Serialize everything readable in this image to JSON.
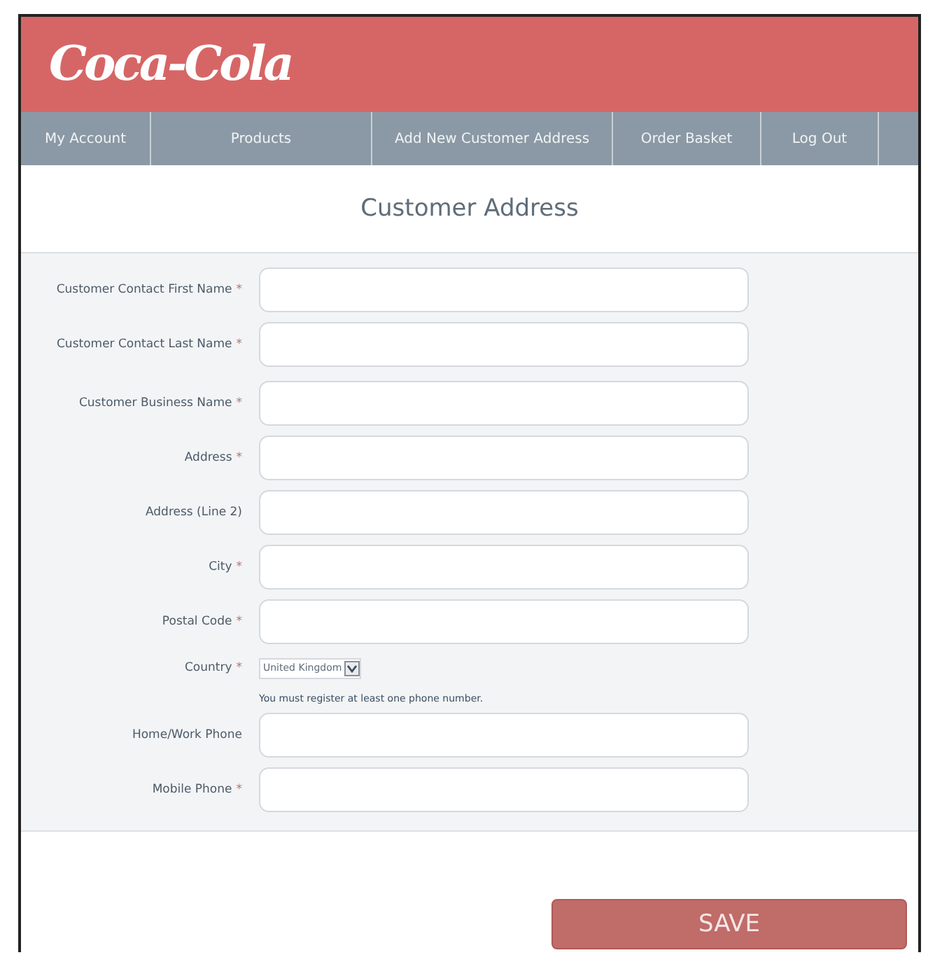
{
  "logo": {
    "text": "Coca-Cola"
  },
  "nav": [
    {
      "label": "My Account"
    },
    {
      "label": "Products"
    },
    {
      "label": "Add New Customer Address"
    },
    {
      "label": "Order Basket"
    },
    {
      "label": "Log Out"
    }
  ],
  "page_title": "Customer Address",
  "sections": [
    {
      "fields": [
        {
          "kind": "text",
          "label": "Customer Contact First Name",
          "marker": "*"
        },
        {
          "kind": "text",
          "label": "Customer Contact Last Name",
          "marker": "*"
        }
      ]
    },
    {
      "fields": [
        {
          "kind": "text",
          "label": "Customer Business Name",
          "marker": "*"
        },
        {
          "kind": "text",
          "label": "Address",
          "marker": "*"
        },
        {
          "kind": "text",
          "label": "Address (Line 2)"
        },
        {
          "kind": "text",
          "label": "City",
          "marker": "*"
        },
        {
          "kind": "text",
          "label": "Postal Code",
          "marker": "*"
        },
        {
          "kind": "select",
          "label": "Country",
          "marker": "*",
          "value": "United Kingdom"
        },
        {
          "kind": "note",
          "text": "You must register at least one phone number."
        },
        {
          "kind": "text",
          "label": "Home/Work Phone"
        },
        {
          "kind": "text",
          "label": "Mobile Phone",
          "marker": "*"
        }
      ]
    }
  ],
  "save_button": "SAVE"
}
